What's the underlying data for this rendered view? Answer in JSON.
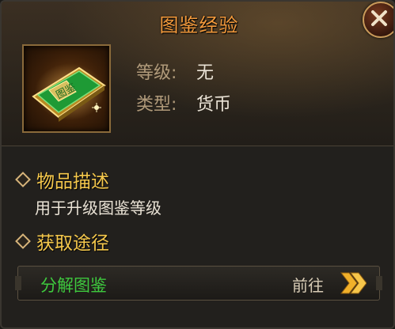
{
  "item": {
    "title": "图鉴经验",
    "icon": "green-book-icon",
    "level_label": "等级:",
    "level_value": "无",
    "type_label": "类型:",
    "type_value": "货币"
  },
  "description": {
    "heading": "物品描述",
    "text": "用于升级图鉴等级"
  },
  "acquire": {
    "heading": "获取途径",
    "sources": [
      {
        "name": "分解图鉴",
        "action": "前往"
      }
    ]
  },
  "colors": {
    "title": "#f39a3c",
    "section_heading": "#f5c84c",
    "source_name": "#3ec93e",
    "text": "#eae3d6"
  }
}
